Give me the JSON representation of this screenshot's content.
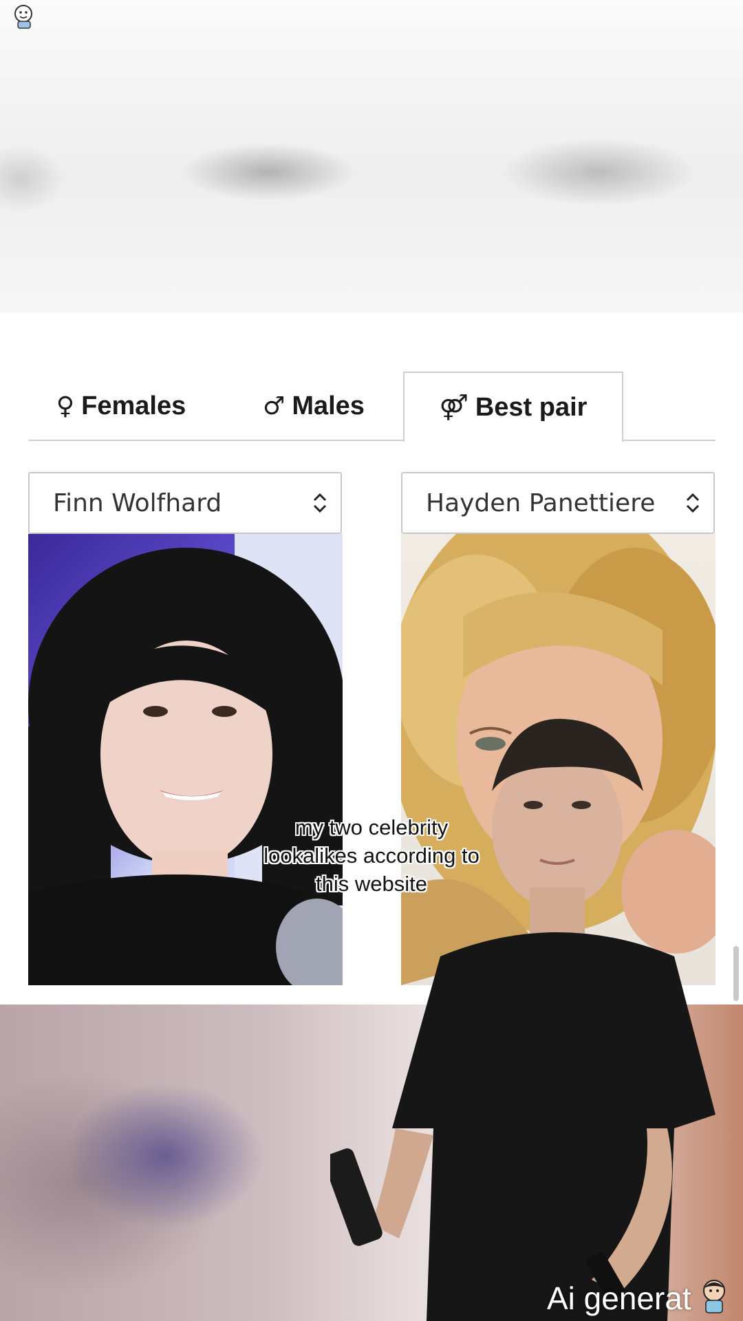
{
  "tabs": {
    "females": {
      "icon": "female-icon",
      "glyph": "♀",
      "label": "Females"
    },
    "males": {
      "icon": "male-icon",
      "glyph": "♂",
      "label": "Males"
    },
    "best_pair": {
      "icon": "gender-pair-icon",
      "glyph": "⚤",
      "label": "Best pair",
      "active": true
    }
  },
  "selects": {
    "left": {
      "value": "Finn Wolfhard"
    },
    "right": {
      "value": "Hayden Panettiere"
    }
  },
  "photos": {
    "left": {
      "subject": "Finn Wolfhard"
    },
    "right": {
      "subject": "Hayden Panettiere"
    }
  },
  "overlay": {
    "caption_line1": "my two celebrity",
    "caption_line2": "lookalikes according to",
    "caption_line3": "this website",
    "watermark": "Ai generat"
  },
  "colors": {
    "tab_border": "#d0d0d0",
    "text": "#1a1a1a"
  }
}
